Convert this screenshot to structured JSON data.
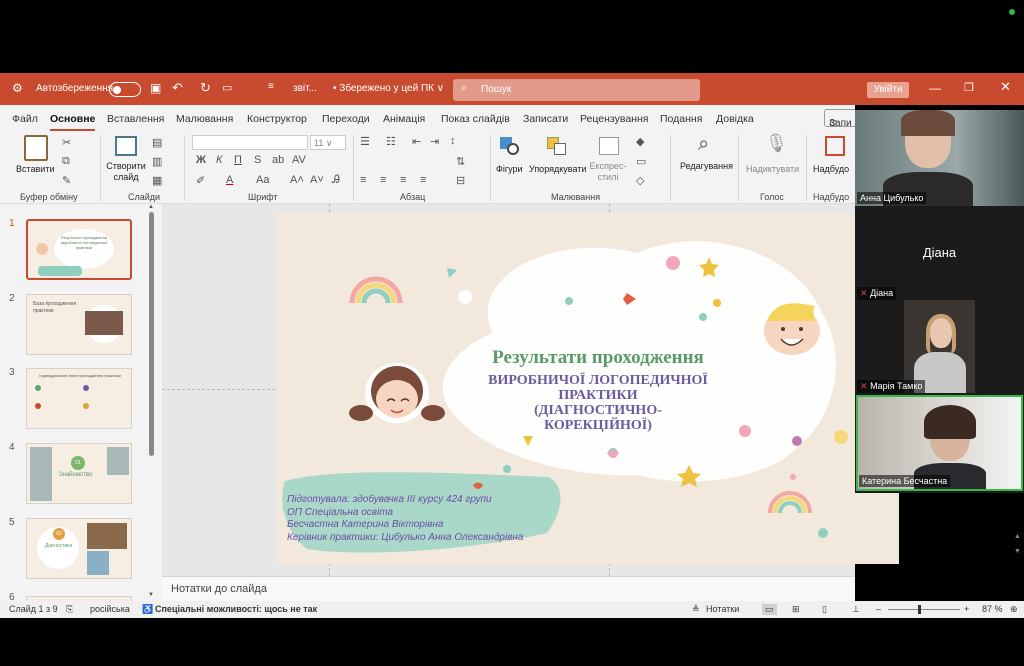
{
  "titlebar": {
    "autosave": "Автозбереження",
    "filename": "звіт...",
    "saved": "• Збережено у цей ПК ∨",
    "search_placeholder": "Пошук",
    "signin": "Увійти"
  },
  "tabs": [
    "Файл",
    "Основне",
    "Вставлення",
    "Малювання",
    "Конструктор",
    "Переходи",
    "Анімація",
    "Показ слайдів",
    "Записати",
    "Рецензування",
    "Подання",
    "Довідка"
  ],
  "record_btn": "Запи",
  "ribbon": {
    "paste": "Вставити",
    "clipboard_group": "Буфер обміну",
    "new_slide": "Створити слайд",
    "slides_group": "Слайди",
    "font_size": "11",
    "font_group": "Шрифт",
    "paragraph_group": "Абзац",
    "shapes": "Фігури",
    "arrange": "Упорядкувати",
    "quick_styles": "Експрес-стилі",
    "drawing_group": "Малювання",
    "editing": "Редагування",
    "dictate": "Надиктувати",
    "voice_group": "Голос",
    "addins": "Надбудо",
    "addins_group": "Надбудо"
  },
  "slide_numbers": [
    "1",
    "2",
    "3",
    "4",
    "5",
    "6"
  ],
  "thumbnails": {
    "t1": "Результати проходження виробничої логопедичної практики",
    "t2": "База проходження практики",
    "t3": "Індивідуальний план проходження практики",
    "t4_num": "01",
    "t4": "Знайомство",
    "t5_num": "02",
    "t5": "Діагностика"
  },
  "slide": {
    "title": "Результати проходження",
    "subtitle_lines": [
      "ВИРОБНИЧОЇ ЛОГОПЕДИЧНОЇ",
      "ПРАКТИКИ",
      "(ДІАГНОСТИЧНО-",
      "КОРЕКЦІЙНОЇ)"
    ],
    "info_lines": [
      "Підготувала: здобувачка  ІІІ курсу 424 групи",
      "ОП Спеціальна освіта",
      "Бесчастна Катерина Вікторівна",
      "Керівник практики:  Цибулько Анна Олександрівна"
    ]
  },
  "notes": "Нотатки до слайда",
  "status": {
    "slide": "Слайд 1 з 9",
    "language": "російська",
    "accessibility": "Спеціальні можливості: щось не так",
    "notes": "Нотатки",
    "zoom": "87 %"
  },
  "participants": [
    {
      "name": "Анна Цибулько"
    },
    {
      "name": "Діана"
    },
    {
      "name": "Марія Тамко"
    },
    {
      "name": "Катерина Бесчастна"
    }
  ],
  "center_name": "Діана",
  "colors": {
    "accent": "#c84b2f",
    "title_green": "#5a9a6a",
    "title_purple": "#6a5aa0",
    "info_purple": "#6b4ea8",
    "video_active": "#3cb54a"
  }
}
